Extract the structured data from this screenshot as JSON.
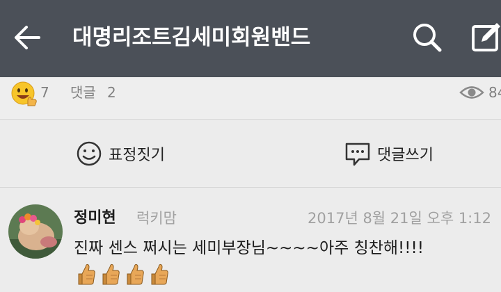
{
  "header": {
    "title": "대명리조트김세미회원밴드",
    "back_icon": "arrow-left-icon",
    "search_icon": "search-icon",
    "write_icon": "compose-icon",
    "background": "#4b5058"
  },
  "stats": {
    "reaction_icon": "smiley-thumbs-up-icon",
    "reaction_count": "7",
    "comment_label": "댓글",
    "comment_count": "2",
    "view_icon": "eye-icon",
    "view_count": "84"
  },
  "actions": {
    "emotion_label": "표정짓기",
    "emotion_icon": "smiley-outline-icon",
    "comment_label": "댓글쓰기",
    "comment_icon": "speech-bubble-icon"
  },
  "comment": {
    "author": "정미현",
    "nickname": "럭키맘",
    "timestamp": "2017년 8월 21일 오후 1:12",
    "text": "진짜 센스 쩌시는 세미부장님~~~~아주 칭찬해!!!!",
    "emoji": "thumbs-up-emoji",
    "emoji_count": 4
  }
}
